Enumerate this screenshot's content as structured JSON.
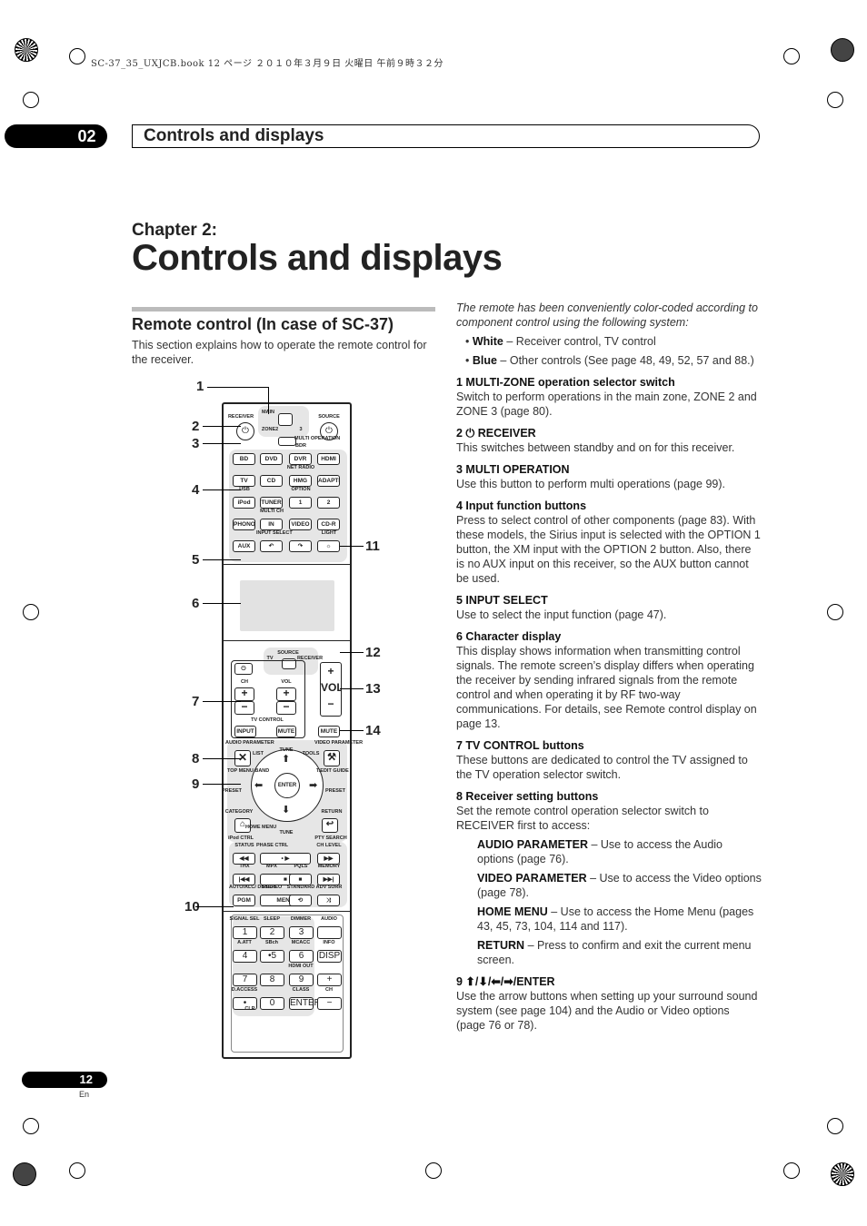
{
  "print_header": "SC-37_35_UXJCB.book  12 ページ  ２０１０年３月９日  火曜日  午前９時３２分",
  "header": {
    "chapter_number": "02",
    "title": "Controls and displays"
  },
  "chapter": {
    "label": "Chapter 2:",
    "title": "Controls and displays"
  },
  "section": {
    "title": "Remote control (In case of SC-37)",
    "intro": "This section explains how to operate the remote control for the receiver."
  },
  "right": {
    "intro": "The remote has been conveniently color-coded according to component control using the following system:",
    "bullets": [
      {
        "b": "White",
        "t": " – Receiver control, TV control"
      },
      {
        "b": "Blue",
        "t": " – Other controls (See page 48, 49, 52, 57 and 88.)"
      }
    ],
    "items": [
      {
        "h": "1    MULTI-ZONE operation selector switch",
        "p": "Switch to perform operations in the main zone, ZONE 2 and ZONE 3 (page 80)."
      },
      {
        "h": "2    ⏻ RECEIVER",
        "p": "This switches between standby and on for this receiver."
      },
      {
        "h": "3    MULTI OPERATION",
        "p": "Use this button to perform multi operations (page 99)."
      },
      {
        "h": "4    Input function buttons",
        "p": "Press to select control of other components (page 83). With these models, the Sirius input is selected with the OPTION 1 button, the XM input with the OPTION 2 button. Also, there is no AUX input on this receiver, so the AUX button cannot be used."
      },
      {
        "h": "5    INPUT SELECT",
        "p": "Use to select the input function (page 47)."
      },
      {
        "h": "6    Character display",
        "p": "This display shows information when transmitting control signals. The remote screen’s display differs when operating the receiver by sending infrared signals from the remote control and when operating it by RF two-way communications. For details, see Remote control display on page 13."
      },
      {
        "h": "7    TV CONTROL buttons",
        "p": "These buttons are dedicated to control the TV assigned to the TV operation selector switch."
      },
      {
        "h": "8    Receiver setting buttons",
        "p": "Set the remote control operation selector switch to RECEIVER first to access:"
      }
    ],
    "sub": [
      {
        "b": "AUDIO PARAMETER",
        "t": " – Use to access the Audio options (page 76)."
      },
      {
        "b": "VIDEO PARAMETER",
        "t": " – Use to access the Video options (page 78)."
      },
      {
        "b": "HOME MENU",
        "t": " – Use to access the Home Menu (pages 43, 45, 73, 104, 114 and 117)."
      },
      {
        "b": "RETURN",
        "t": " – Press to confirm and exit the current menu screen."
      }
    ],
    "item9": {
      "h": "9    ⬆/⬇/⬅/➡/ENTER",
      "p": "Use the arrow buttons when setting up your surround sound system (see page 104) and the Audio or Video options (page 76 or 78)."
    }
  },
  "remote": {
    "top": {
      "receiver": "RECEIVER",
      "main": "MAIN",
      "zone": "ZONE2",
      "three": "3",
      "source": "SOURCE",
      "multi": "MULTI OPERATION",
      "power_icon": "⏻"
    },
    "input_rows": [
      {
        "caps": [
          "",
          "",
          "BDR",
          ""
        ],
        "btns": [
          "BD",
          "DVD",
          "DVR",
          "HDMI"
        ]
      },
      {
        "caps": [
          "",
          "",
          "NET RADIO",
          ""
        ],
        "btns": [
          "TV",
          "CD",
          "HMG",
          "ADAPTER"
        ]
      },
      {
        "caps": [
          "USB",
          "",
          "OPTION",
          ""
        ],
        "btns": [
          "iPod",
          "TUNER",
          "1",
          "2"
        ]
      },
      {
        "caps": [
          "",
          "MULTI CH",
          "",
          ""
        ],
        "btns": [
          "PHONO",
          "IN",
          "VIDEO",
          "CD-R"
        ]
      },
      {
        "caps": [
          "",
          "INPUT SELECT",
          "",
          "LIGHT"
        ],
        "btns": [
          "AUX",
          "↶",
          "↷",
          "☼"
        ]
      }
    ],
    "tv": {
      "source": "SOURCE",
      "tv": "TV",
      "receiver": "RECEIVER",
      "ch": "CH",
      "vol": "VOL",
      "plus": "+",
      "minus": "−",
      "control": "TV CONTROL",
      "input": "INPUT",
      "mute": "MUTE",
      "vol_right": "VOL",
      "mute_right": "MUTE",
      "tv_power": "⏻"
    },
    "nav": {
      "audio_param": "AUDIO PARAMETER",
      "list": "LIST",
      "tune": "TUNE",
      "tools": "TOOLS",
      "video_param": "VIDEO PARAMETER",
      "top_menu": "TOP MENU BAND",
      "t_edit": "T.EDIT GUIDE",
      "preset": "PRESET",
      "enter": "ENTER",
      "category": "CATEGORY",
      "return": "RETURN",
      "home_menu": "HOME MENU",
      "ipod_ctrl": "iPod CTRL",
      "pty": "PTY SEARCH"
    },
    "lower_rows": [
      {
        "caps": [
          "STATUS",
          "PHASE CTRL",
          "",
          "CH LEVEL"
        ],
        "btns": [
          "◀◀",
          "•  ▶",
          "",
          "▶▶"
        ]
      },
      {
        "caps": [
          "THX",
          "MPX",
          "PQLS",
          "MEMORY"
        ],
        "btns": [
          "|◀◀",
          "■",
          "■",
          "▶▶|"
        ]
      },
      {
        "caps": [
          "AUTO/ALC/ DIRECT",
          "STEREO",
          "STANDARD",
          "ADV SURR"
        ],
        "btns": [
          "PGM",
          "MENU",
          "⟲",
          "⤨"
        ]
      }
    ],
    "pad_rows": [
      {
        "caps": [
          "SIGNAL SEL",
          "SLEEP",
          "DIMMER",
          "AUDIO"
        ],
        "btns": [
          "1",
          "2",
          "3",
          ""
        ]
      },
      {
        "caps": [
          "A.ATT",
          "SBch",
          "MCACC",
          "INFO"
        ],
        "btns": [
          "4",
          "•5",
          "6",
          "DISP"
        ]
      },
      {
        "caps": [
          "",
          "",
          "HDMI OUT",
          ""
        ],
        "btns": [
          "7",
          "8",
          "9",
          "+"
        ]
      },
      {
        "caps": [
          "D.ACCESS",
          "",
          "CLASS",
          "CH"
        ],
        "btns": [
          "•",
          "0",
          "ENTER",
          "−"
        ]
      }
    ],
    "clr": "CLR"
  },
  "callouts": [
    "1",
    "2",
    "3",
    "4",
    "5",
    "6",
    "7",
    "8",
    "9",
    "10",
    "11",
    "12",
    "13",
    "14"
  ],
  "footer": {
    "page": "12",
    "lang": "En"
  }
}
